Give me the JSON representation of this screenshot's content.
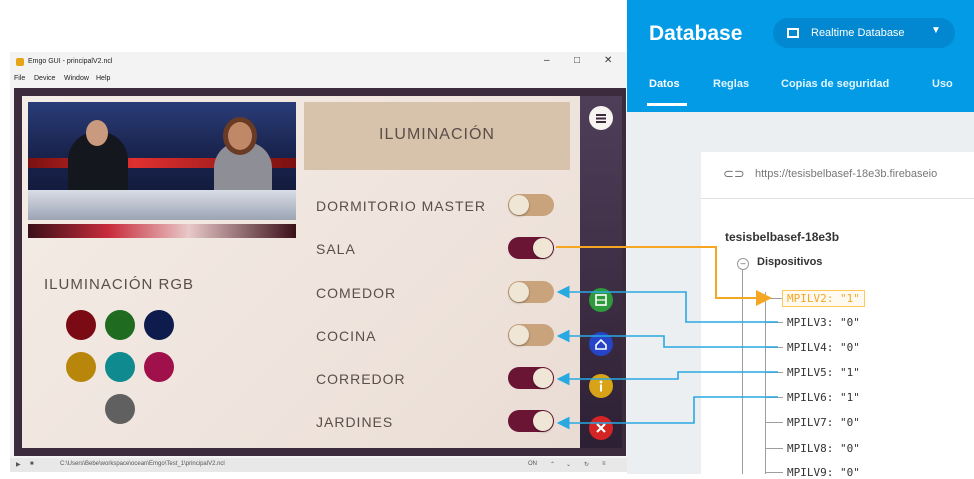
{
  "window": {
    "title": "Emgo GUI - principalV2.ncl",
    "controls": [
      "–",
      "□",
      "✕"
    ],
    "menu": [
      "File",
      "Device",
      "Window",
      "Help"
    ],
    "status_path": "C:\\Users\\Bebe\\workspace\\ocean\\Emgo\\Test_1\\principalV2.ncl",
    "status_toggle": "ON"
  },
  "app": {
    "illumination_title": "ILUMINACIÓN",
    "rgb_title": "ILUMINACIÓN RGB",
    "rooms": [
      {
        "label": "DORMITORIO MASTER",
        "on": false
      },
      {
        "label": "SALA",
        "on": true
      },
      {
        "label": "COMEDOR",
        "on": false
      },
      {
        "label": "COCINA",
        "on": false
      },
      {
        "label": "CORREDOR",
        "on": true
      },
      {
        "label": "JARDINES",
        "on": true
      }
    ],
    "rgb_colors": [
      "#7a0a14",
      "#1f6b1f",
      "#0d1c4c",
      "#b8860b",
      "#0f8a8f",
      "#a0104a",
      "#606060"
    ],
    "nav_icons": [
      "menu-icon",
      "grid-icon",
      "home-icon",
      "info-icon",
      "close-icon"
    ]
  },
  "firebase": {
    "title": "Database",
    "selector": "Realtime Database",
    "tabs": [
      "Datos",
      "Reglas",
      "Copias de seguridad",
      "Uso"
    ],
    "active_tab": "Datos",
    "url": "https://tesisbelbasef-18e3b.firebaseio",
    "root": "tesisbelbasef-18e3b",
    "node": "Dispositivos",
    "items": [
      "MPILV2: \"1\"",
      "MPILV3: \"0\"",
      "MPILV4: \"0\"",
      "MPILV5: \"1\"",
      "MPILV6: \"1\"",
      "MPILV7: \"0\"",
      "MPILV8: \"0\"",
      "MPILV9: \"0\""
    ],
    "highlight_color": "#f5a623",
    "link_color": "#29a9e1"
  }
}
